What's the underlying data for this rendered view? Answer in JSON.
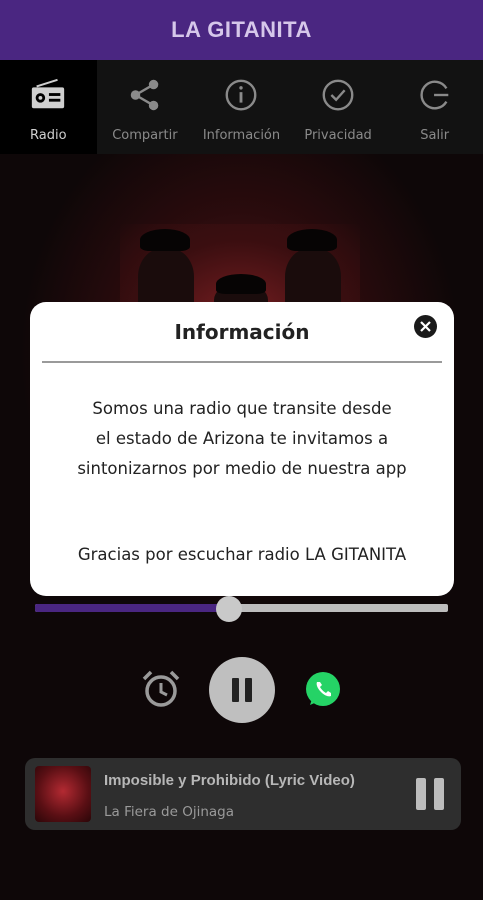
{
  "app": {
    "title": "LA GITANITA"
  },
  "tabs": [
    {
      "label": "Radio",
      "icon": "radio-icon",
      "active": true
    },
    {
      "label": "Compartir",
      "icon": "share-icon",
      "active": false
    },
    {
      "label": "Información",
      "icon": "info-icon",
      "active": false
    },
    {
      "label": "Privacidad",
      "icon": "check-circle-icon",
      "active": false
    },
    {
      "label": "Salir",
      "icon": "exit-icon",
      "active": false
    }
  ],
  "modal": {
    "title": "Información",
    "body_lines": [
      "Somos una radio que transite desde",
      "el estado de Arizona te invitamos a",
      "sintonizarnos por medio de nuestra app"
    ],
    "thanks": "Gracias por escuchar radio LA GITANITA",
    "close_icon": "close-icon"
  },
  "player": {
    "progress": 0.47,
    "controls": [
      "alarm-clock-icon",
      "pause-icon",
      "whatsapp-icon"
    ],
    "now_playing": {
      "song": "Imposible y Prohibido (Lyric Video)",
      "artist": "La Fiera de Ojinaga"
    }
  },
  "colors": {
    "brand_purple": "#4a2681",
    "title_text": "#d6c7ea",
    "whatsapp_green": "#25d366"
  }
}
